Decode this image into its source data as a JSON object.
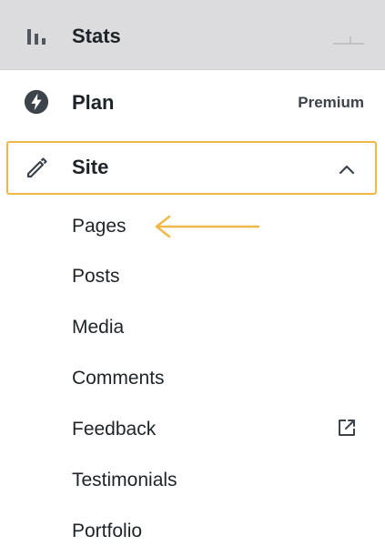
{
  "menu": {
    "stats": {
      "label": "Stats",
      "icon": "bar-chart-icon"
    },
    "plan": {
      "label": "Plan",
      "badge": "Premium",
      "icon": "bolt-icon"
    },
    "site": {
      "label": "Site",
      "icon": "pencil-icon",
      "expanded": true,
      "highlight_color": "#f0b849"
    },
    "submenu": [
      {
        "label": "Pages"
      },
      {
        "label": "Posts"
      },
      {
        "label": "Media"
      },
      {
        "label": "Comments"
      },
      {
        "label": "Feedback",
        "icon": "external-link-icon"
      },
      {
        "label": "Testimonials"
      },
      {
        "label": "Portfolio"
      }
    ]
  },
  "colors": {
    "accent": "#f0b849",
    "selected_bg": "#dcdcde",
    "text": "#1d2327"
  }
}
